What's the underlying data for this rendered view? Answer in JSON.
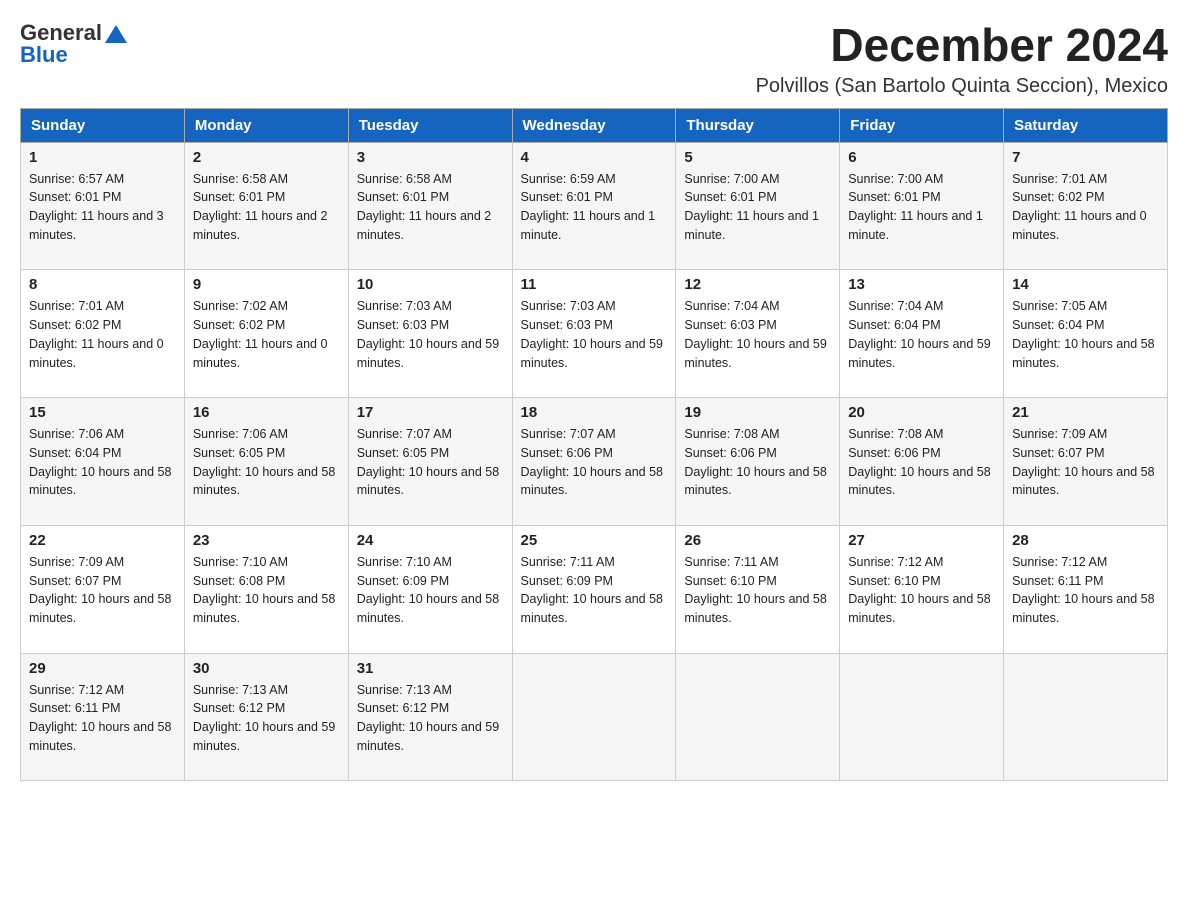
{
  "header": {
    "logo_general": "General",
    "logo_blue": "Blue",
    "month_title": "December 2024",
    "location": "Polvillos (San Bartolo Quinta Seccion), Mexico"
  },
  "days_of_week": [
    "Sunday",
    "Monday",
    "Tuesday",
    "Wednesday",
    "Thursday",
    "Friday",
    "Saturday"
  ],
  "weeks": [
    [
      {
        "day": "1",
        "sunrise": "6:57 AM",
        "sunset": "6:01 PM",
        "daylight": "11 hours and 3 minutes."
      },
      {
        "day": "2",
        "sunrise": "6:58 AM",
        "sunset": "6:01 PM",
        "daylight": "11 hours and 2 minutes."
      },
      {
        "day": "3",
        "sunrise": "6:58 AM",
        "sunset": "6:01 PM",
        "daylight": "11 hours and 2 minutes."
      },
      {
        "day": "4",
        "sunrise": "6:59 AM",
        "sunset": "6:01 PM",
        "daylight": "11 hours and 1 minute."
      },
      {
        "day": "5",
        "sunrise": "7:00 AM",
        "sunset": "6:01 PM",
        "daylight": "11 hours and 1 minute."
      },
      {
        "day": "6",
        "sunrise": "7:00 AM",
        "sunset": "6:01 PM",
        "daylight": "11 hours and 1 minute."
      },
      {
        "day": "7",
        "sunrise": "7:01 AM",
        "sunset": "6:02 PM",
        "daylight": "11 hours and 0 minutes."
      }
    ],
    [
      {
        "day": "8",
        "sunrise": "7:01 AM",
        "sunset": "6:02 PM",
        "daylight": "11 hours and 0 minutes."
      },
      {
        "day": "9",
        "sunrise": "7:02 AM",
        "sunset": "6:02 PM",
        "daylight": "11 hours and 0 minutes."
      },
      {
        "day": "10",
        "sunrise": "7:03 AM",
        "sunset": "6:03 PM",
        "daylight": "10 hours and 59 minutes."
      },
      {
        "day": "11",
        "sunrise": "7:03 AM",
        "sunset": "6:03 PM",
        "daylight": "10 hours and 59 minutes."
      },
      {
        "day": "12",
        "sunrise": "7:04 AM",
        "sunset": "6:03 PM",
        "daylight": "10 hours and 59 minutes."
      },
      {
        "day": "13",
        "sunrise": "7:04 AM",
        "sunset": "6:04 PM",
        "daylight": "10 hours and 59 minutes."
      },
      {
        "day": "14",
        "sunrise": "7:05 AM",
        "sunset": "6:04 PM",
        "daylight": "10 hours and 58 minutes."
      }
    ],
    [
      {
        "day": "15",
        "sunrise": "7:06 AM",
        "sunset": "6:04 PM",
        "daylight": "10 hours and 58 minutes."
      },
      {
        "day": "16",
        "sunrise": "7:06 AM",
        "sunset": "6:05 PM",
        "daylight": "10 hours and 58 minutes."
      },
      {
        "day": "17",
        "sunrise": "7:07 AM",
        "sunset": "6:05 PM",
        "daylight": "10 hours and 58 minutes."
      },
      {
        "day": "18",
        "sunrise": "7:07 AM",
        "sunset": "6:06 PM",
        "daylight": "10 hours and 58 minutes."
      },
      {
        "day": "19",
        "sunrise": "7:08 AM",
        "sunset": "6:06 PM",
        "daylight": "10 hours and 58 minutes."
      },
      {
        "day": "20",
        "sunrise": "7:08 AM",
        "sunset": "6:06 PM",
        "daylight": "10 hours and 58 minutes."
      },
      {
        "day": "21",
        "sunrise": "7:09 AM",
        "sunset": "6:07 PM",
        "daylight": "10 hours and 58 minutes."
      }
    ],
    [
      {
        "day": "22",
        "sunrise": "7:09 AM",
        "sunset": "6:07 PM",
        "daylight": "10 hours and 58 minutes."
      },
      {
        "day": "23",
        "sunrise": "7:10 AM",
        "sunset": "6:08 PM",
        "daylight": "10 hours and 58 minutes."
      },
      {
        "day": "24",
        "sunrise": "7:10 AM",
        "sunset": "6:09 PM",
        "daylight": "10 hours and 58 minutes."
      },
      {
        "day": "25",
        "sunrise": "7:11 AM",
        "sunset": "6:09 PM",
        "daylight": "10 hours and 58 minutes."
      },
      {
        "day": "26",
        "sunrise": "7:11 AM",
        "sunset": "6:10 PM",
        "daylight": "10 hours and 58 minutes."
      },
      {
        "day": "27",
        "sunrise": "7:12 AM",
        "sunset": "6:10 PM",
        "daylight": "10 hours and 58 minutes."
      },
      {
        "day": "28",
        "sunrise": "7:12 AM",
        "sunset": "6:11 PM",
        "daylight": "10 hours and 58 minutes."
      }
    ],
    [
      {
        "day": "29",
        "sunrise": "7:12 AM",
        "sunset": "6:11 PM",
        "daylight": "10 hours and 58 minutes."
      },
      {
        "day": "30",
        "sunrise": "7:13 AM",
        "sunset": "6:12 PM",
        "daylight": "10 hours and 59 minutes."
      },
      {
        "day": "31",
        "sunrise": "7:13 AM",
        "sunset": "6:12 PM",
        "daylight": "10 hours and 59 minutes."
      },
      null,
      null,
      null,
      null
    ]
  ],
  "labels": {
    "sunrise": "Sunrise:",
    "sunset": "Sunset:",
    "daylight": "Daylight:"
  }
}
